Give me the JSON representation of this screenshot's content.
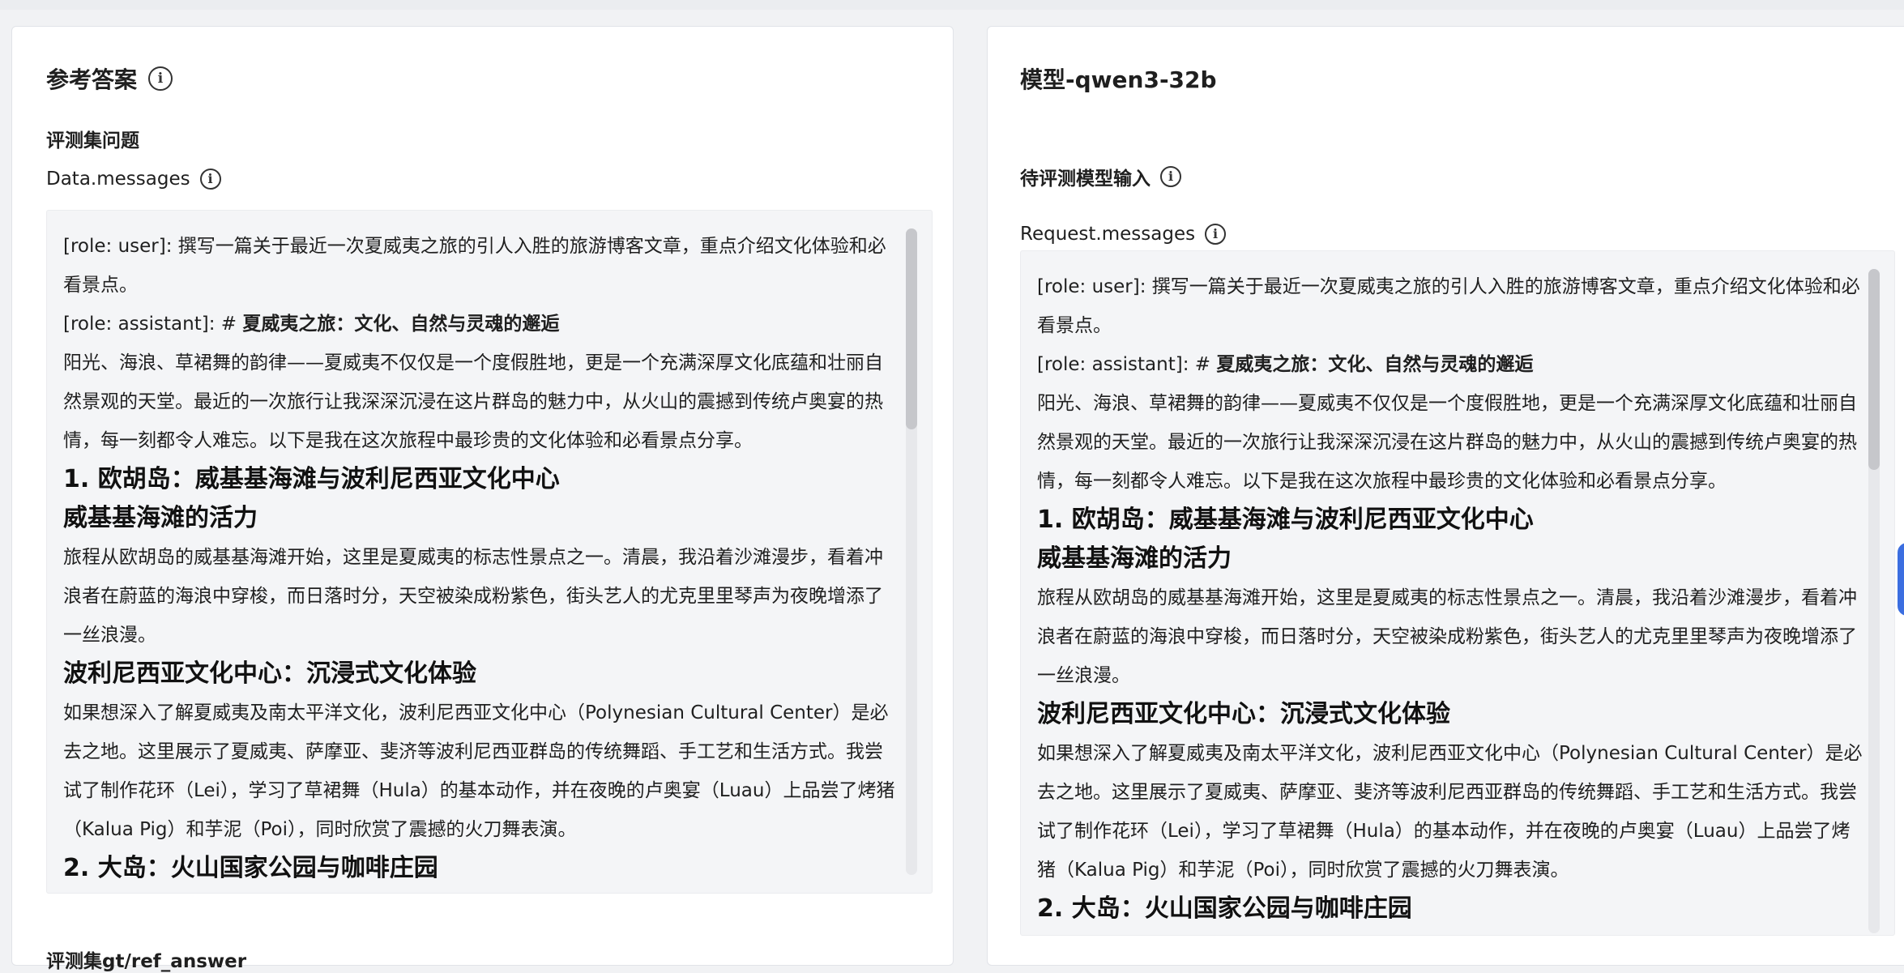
{
  "left_panel": {
    "title": "参考答案",
    "section_label": "评测集问题",
    "field_label": "Data.messages",
    "bottom_label": "评测集gt/ref_answer"
  },
  "right_panel": {
    "title": "模型-qwen3-32b",
    "section_label": "待评测模型输入",
    "field_label": "Request.messages"
  },
  "info_icon_glyph": "i",
  "left_messages": {
    "user_line": "[role: user]: 撰写一篇关于最近一次夏威夷之旅的引人入胜的旅游博客文章，重点介绍文化体验和必看景点。",
    "assistant_prefix": "[role: assistant]: # ",
    "assistant_title": "夏威夷之旅：文化、自然与灵魂的邂逅",
    "intro": "阳光、海浪、草裙舞的韵律——夏威夷不仅仅是一个度假胜地，更是一个充满深厚文化底蕴和壮丽自然景观的天堂。最近的一次旅行让我深深沉浸在这片群岛的魅力中，从火山的震撼到传统卢奥宴的热情，每一刻都令人难忘。以下是我在这次旅程中最珍贵的文化体验和必看景点分享。",
    "h1": "1. 欧胡岛：威基基海滩与波利尼西亚文化中心",
    "h2": "威基基海滩的活力",
    "p1": "旅程从欧胡岛的威基基海滩开始，这里是夏威夷的标志性景点之一。清晨，我沿着沙滩漫步，看着冲浪者在蔚蓝的海浪中穿梭，而日落时分，天空被染成粉紫色，街头艺人的尤克里里琴声为夜晚增添了一丝浪漫。",
    "h3": "波利尼西亚文化中心：沉浸式文化体验",
    "p2": "如果想深入了解夏威夷及南太平洋文化，波利尼西亚文化中心（Polynesian Cultural Center）是必去之地。这里展示了夏威夷、萨摩亚、斐济等波利尼西亚群岛的传统舞蹈、手工艺和生活方式。我尝试了制作花环（Lei），学习了草裙舞（Hula）的基本动作，并在夜晚的卢奥宴（Luau）上品尝了烤猪（Kalua Pig）和芋泥（Poi），同时欣赏了震撼的火刀舞表演。",
    "h4": "2. 大岛：火山国家公园与咖啡庄园"
  },
  "right_messages": {
    "user_line": "[role: user]: 撰写一篇关于最近一次夏威夷之旅的引人入胜的旅游博客文章，重点介绍文化体验和必看景点。",
    "assistant_prefix": "[role: assistant]: # ",
    "assistant_title": "夏威夷之旅：文化、自然与灵魂的邂逅",
    "intro": "阳光、海浪、草裙舞的韵律——夏威夷不仅仅是一个度假胜地，更是一个充满深厚文化底蕴和壮丽自然景观的天堂。最近的一次旅行让我深深沉浸在这片群岛的魅力中，从火山的震撼到传统卢奥宴的热情，每一刻都令人难忘。以下是我在这次旅程中最珍贵的文化体验和必看景点分享。",
    "h1": "1. 欧胡岛：威基基海滩与波利尼西亚文化中心",
    "h2": "威基基海滩的活力",
    "p1": "旅程从欧胡岛的威基基海滩开始，这里是夏威夷的标志性景点之一。清晨，我沿着沙滩漫步，看着冲浪者在蔚蓝的海浪中穿梭，而日落时分，天空被染成粉紫色，街头艺人的尤克里里琴声为夜晚增添了一丝浪漫。",
    "h3": "波利尼西亚文化中心：沉浸式文化体验",
    "p2": "如果想深入了解夏威夷及南太平洋文化，波利尼西亚文化中心（Polynesian Cultural Center）是必去之地。这里展示了夏威夷、萨摩亚、斐济等波利尼西亚群岛的传统舞蹈、手工艺和生活方式。我尝试了制作花环（Lei），学习了草裙舞（Hula）的基本动作，并在夜晚的卢奥宴（Luau）上品尝了烤猪（Kalua Pig）和芋泥（Poi），同时欣赏了震撼的火刀舞表演。",
    "h4": "2. 大岛：火山国家公园与咖啡庄园"
  },
  "colors": {
    "page_bg": "#f1f2f4",
    "panel_bg": "#ffffff",
    "box_bg": "#f4f5f7",
    "scroll_thumb": "#c6c7cb",
    "edge_tab": "#3b6ee0"
  }
}
